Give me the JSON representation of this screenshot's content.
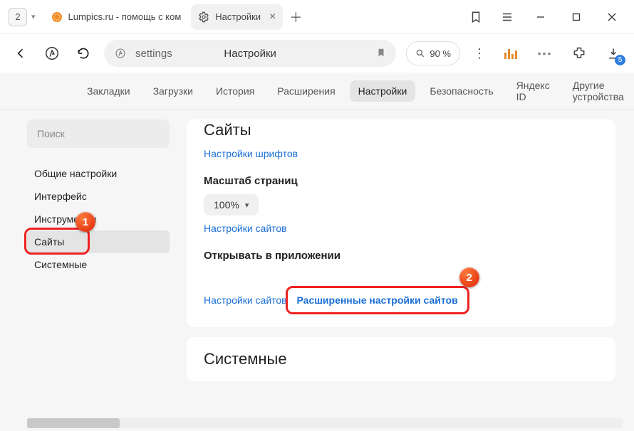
{
  "titlebar": {
    "tab_count": "2",
    "tabs": [
      {
        "title": "Lumpics.ru - помощь с ком",
        "favicon": "orange-circle"
      },
      {
        "title": "Настройки",
        "favicon": "gear"
      }
    ]
  },
  "toolbar": {
    "address": "settings",
    "page_title": "Настройки",
    "zoom_label": "90 %",
    "download_badge": "5"
  },
  "navtabs": {
    "items": [
      "Закладки",
      "Загрузки",
      "История",
      "Расширения",
      "Настройки",
      "Безопасность",
      "Яндекс ID",
      "Другие устройства"
    ],
    "active_index": 4
  },
  "sidebar": {
    "search_placeholder": "Поиск",
    "items": [
      "Общие настройки",
      "Интерфейс",
      "Инструменты",
      "Сайты",
      "Системные"
    ],
    "active_index": 3
  },
  "main": {
    "section_title": "Сайты",
    "link_fonts": "Настройки шрифтов",
    "scale_heading": "Масштаб страниц",
    "scale_value": "100%",
    "link_sites1": "Настройки сайтов",
    "open_in_app_heading": "Открывать в приложении",
    "link_sites2": "Настройки сайтов",
    "link_advanced": "Расширенные настройки сайтов",
    "next_section_title": "Системные"
  },
  "annotations": {
    "b1": "1",
    "b2": "2"
  }
}
